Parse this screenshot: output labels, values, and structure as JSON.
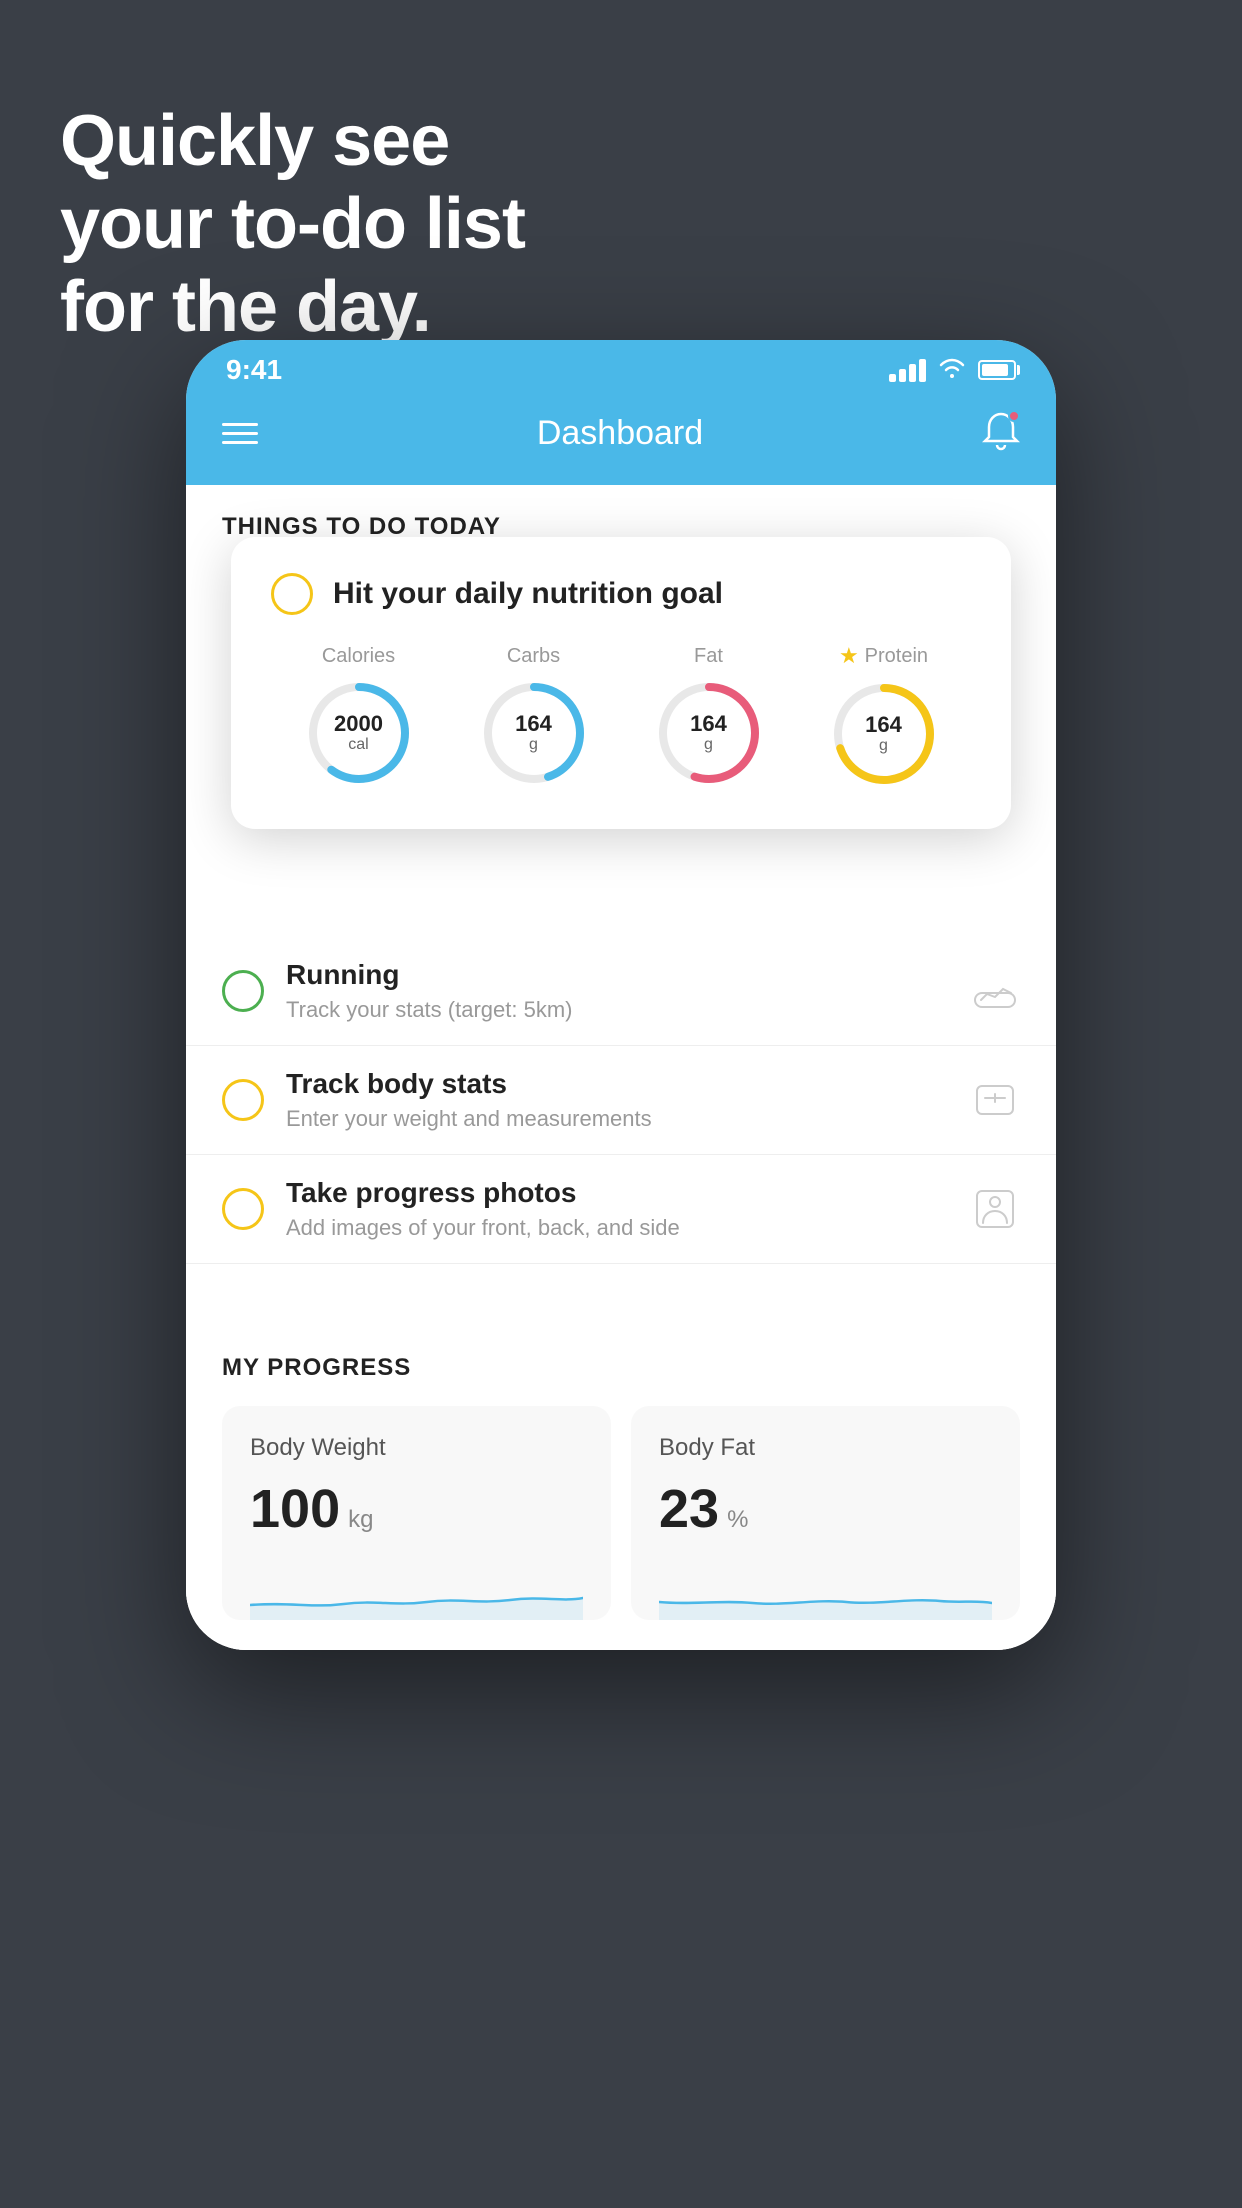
{
  "hero": {
    "title": "Quickly see\nyour to-do list\nfor the day."
  },
  "status_bar": {
    "time": "9:41",
    "signal": "signal",
    "wifi": "wifi",
    "battery": "battery"
  },
  "header": {
    "title": "Dashboard",
    "menu_label": "menu",
    "bell_label": "notifications"
  },
  "things_section": {
    "heading": "THINGS TO DO TODAY"
  },
  "nutrition_card": {
    "title": "Hit your daily nutrition goal",
    "calories": {
      "label": "Calories",
      "value": "2000",
      "unit": "cal",
      "color": "#4ab8e8",
      "progress": 60
    },
    "carbs": {
      "label": "Carbs",
      "value": "164",
      "unit": "g",
      "color": "#4ab8e8",
      "progress": 45
    },
    "fat": {
      "label": "Fat",
      "value": "164",
      "unit": "g",
      "color": "#e85c7a",
      "progress": 55
    },
    "protein": {
      "label": "Protein",
      "value": "164",
      "unit": "g",
      "color": "#f5c518",
      "progress": 70
    }
  },
  "todo_items": [
    {
      "id": "running",
      "title": "Running",
      "subtitle": "Track your stats (target: 5km)",
      "checkbox_color": "green",
      "icon": "shoe"
    },
    {
      "id": "body-stats",
      "title": "Track body stats",
      "subtitle": "Enter your weight and measurements",
      "checkbox_color": "yellow",
      "icon": "scale"
    },
    {
      "id": "progress-photos",
      "title": "Take progress photos",
      "subtitle": "Add images of your front, back, and side",
      "checkbox_color": "yellow",
      "icon": "person"
    }
  ],
  "progress_section": {
    "heading": "MY PROGRESS",
    "body_weight": {
      "label": "Body Weight",
      "value": "100",
      "unit": "kg"
    },
    "body_fat": {
      "label": "Body Fat",
      "value": "23",
      "unit": "%"
    }
  }
}
